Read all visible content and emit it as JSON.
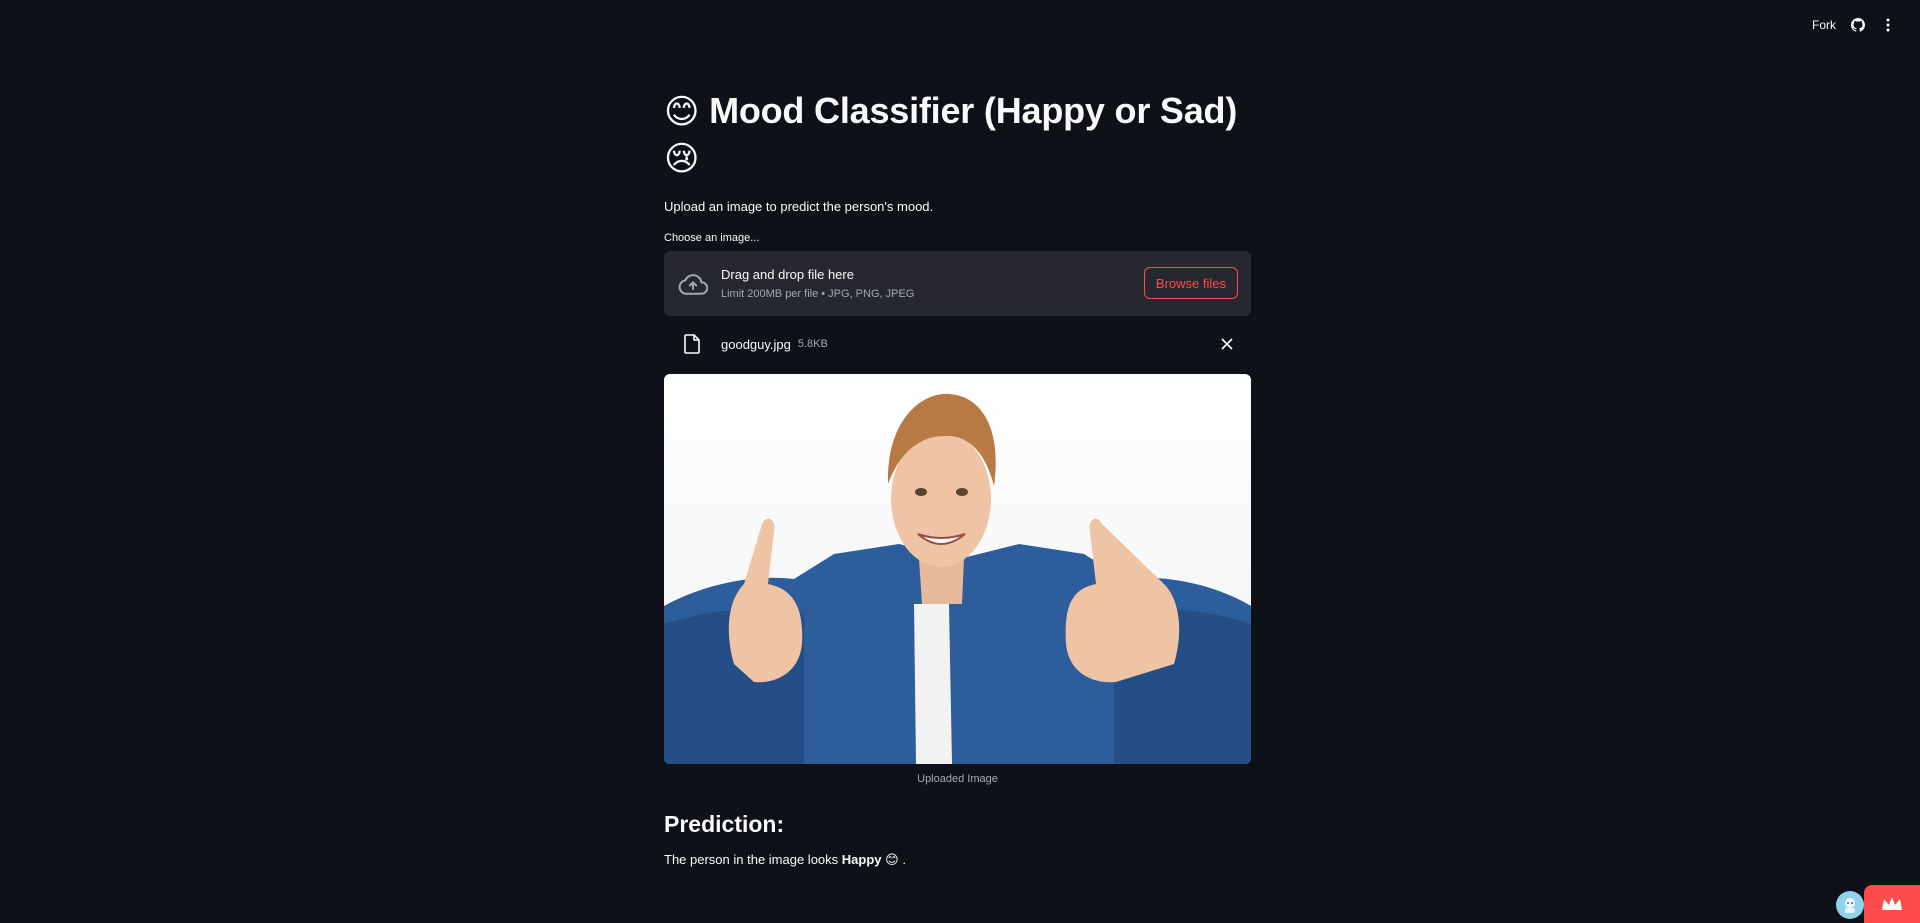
{
  "toolbar": {
    "fork_label": "Fork",
    "icons": [
      "github-icon",
      "more-vertical-icon"
    ]
  },
  "main": {
    "title_emoji_1": "😊",
    "title_text": "Mood Classifier (Happy or Sad)",
    "title_emoji_2": "😢",
    "subtitle": "Upload an image to predict the person's mood.",
    "uploader": {
      "label": "Choose an image...",
      "drop_title": "Drag and drop file here",
      "limit_text": "Limit 200MB per file • JPG, PNG, JPEG",
      "browse_label": "Browse files"
    },
    "file": {
      "name": "goodguy.jpg",
      "size": "5.8KB"
    },
    "image_caption": "Uploaded Image",
    "prediction_heading": "Prediction:",
    "prediction_prefix": "The person in the image looks ",
    "prediction_value": "Happy",
    "prediction_emoji": "😊",
    "prediction_suffix": " ."
  },
  "colors": {
    "background": "#0e1117",
    "surface": "#262730",
    "accent": "#ff4b4b",
    "text": "#fafafa",
    "muted": "#a3a8b8"
  }
}
